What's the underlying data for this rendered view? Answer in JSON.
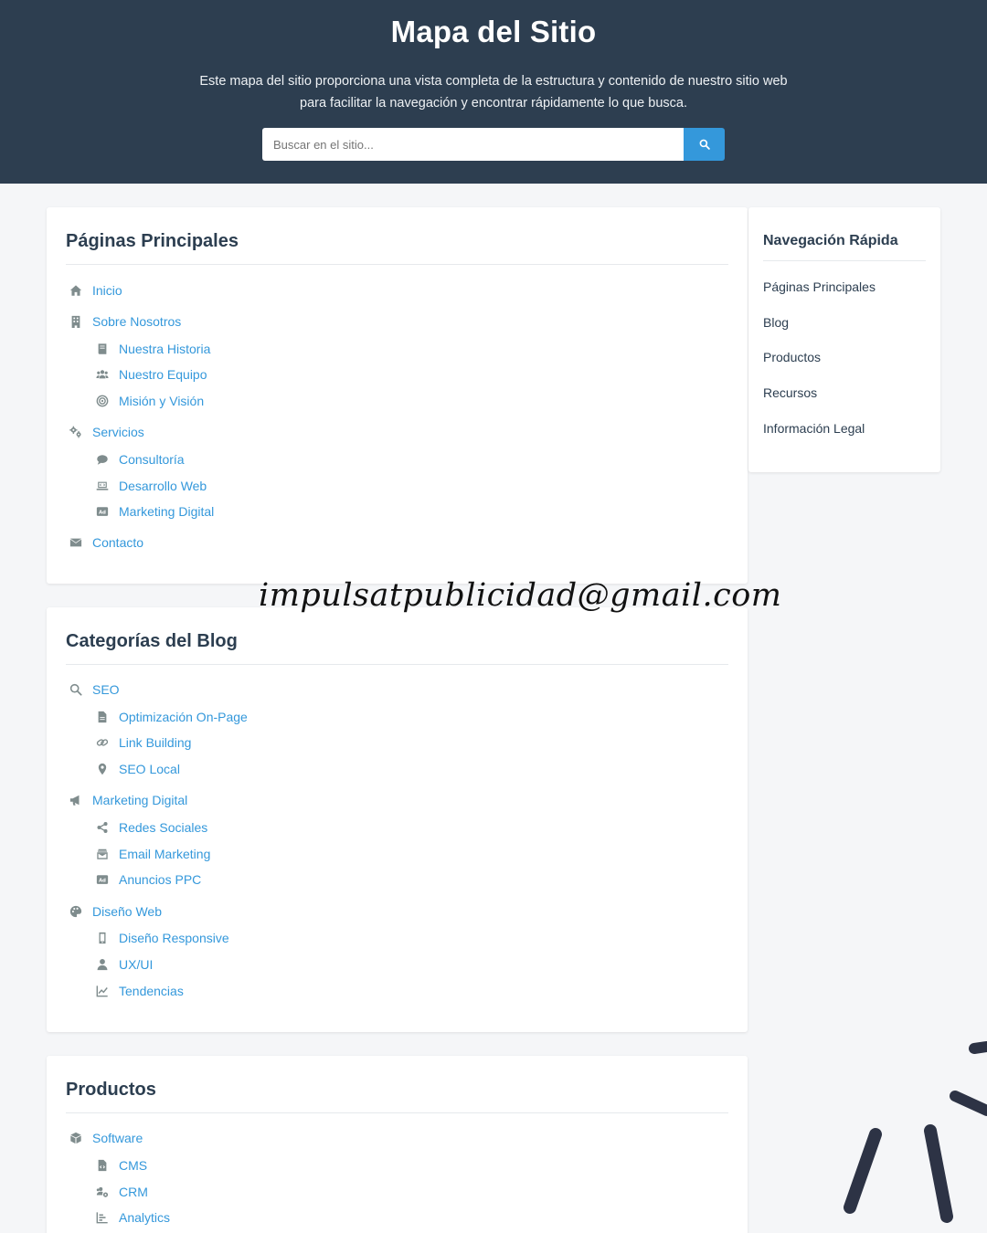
{
  "header": {
    "title": "Mapa del Sitio",
    "description_line1": "Este mapa del sitio proporciona una vista completa de la estructura y contenido de nuestro sitio web",
    "description_line2": "para facilitar la navegación y encontrar rápidamente lo que busca.",
    "search_placeholder": "Buscar en el sitio...",
    "search_icon": "search-icon",
    "search_button_color": "#3498db",
    "background_color": "#2d3e50"
  },
  "sections": {
    "main_pages": {
      "title": "Páginas Principales",
      "items": [
        {
          "label": "Inicio",
          "icon": "home-icon"
        },
        {
          "label": "Sobre Nosotros",
          "icon": "building-icon",
          "children": [
            {
              "label": "Nuestra Historia",
              "icon": "book-icon"
            },
            {
              "label": "Nuestro Equipo",
              "icon": "users-icon"
            },
            {
              "label": "Misión y Visión",
              "icon": "target-icon"
            }
          ]
        },
        {
          "label": "Servicios",
          "icon": "gears-icon",
          "children": [
            {
              "label": "Consultoría",
              "icon": "comment-icon"
            },
            {
              "label": "Desarrollo Web",
              "icon": "laptop-code-icon"
            },
            {
              "label": "Marketing Digital",
              "icon": "ad-icon"
            }
          ]
        },
        {
          "label": "Contacto",
          "icon": "envelope-icon"
        }
      ]
    },
    "blog": {
      "title": "Categorías del Blog",
      "items": [
        {
          "label": "SEO",
          "icon": "search-icon",
          "children": [
            {
              "label": "Optimización On-Page",
              "icon": "file-icon"
            },
            {
              "label": "Link Building",
              "icon": "link-icon"
            },
            {
              "label": "SEO Local",
              "icon": "map-marker-icon"
            }
          ]
        },
        {
          "label": "Marketing Digital",
          "icon": "bullhorn-icon",
          "children": [
            {
              "label": "Redes Sociales",
              "icon": "share-icon"
            },
            {
              "label": "Email Marketing",
              "icon": "mail-bulk-icon"
            },
            {
              "label": "Anuncios PPC",
              "icon": "ad-icon"
            }
          ]
        },
        {
          "label": "Diseño Web",
          "icon": "palette-icon",
          "children": [
            {
              "label": "Diseño Responsive",
              "icon": "mobile-icon"
            },
            {
              "label": "UX/UI",
              "icon": "user-icon"
            },
            {
              "label": "Tendencias",
              "icon": "chart-line-icon"
            }
          ]
        }
      ]
    },
    "products": {
      "title": "Productos",
      "items": [
        {
          "label": "Software",
          "icon": "cube-icon",
          "children": [
            {
              "label": "CMS",
              "icon": "file-code-icon"
            },
            {
              "label": "CRM",
              "icon": "users-cog-icon"
            },
            {
              "label": "Analytics",
              "icon": "chart-bar-icon"
            }
          ]
        }
      ]
    }
  },
  "quick_nav": {
    "title": "Navegación Rápida",
    "links": [
      "Páginas Principales",
      "Blog",
      "Productos",
      "Recursos",
      "Información Legal"
    ]
  },
  "watermark": "impulsatpublicidad@gmail.com",
  "colors": {
    "link": "#3498db",
    "icon": "#7f8c8d",
    "heading": "#2c3e50",
    "page_background": "#f5f6f8"
  }
}
